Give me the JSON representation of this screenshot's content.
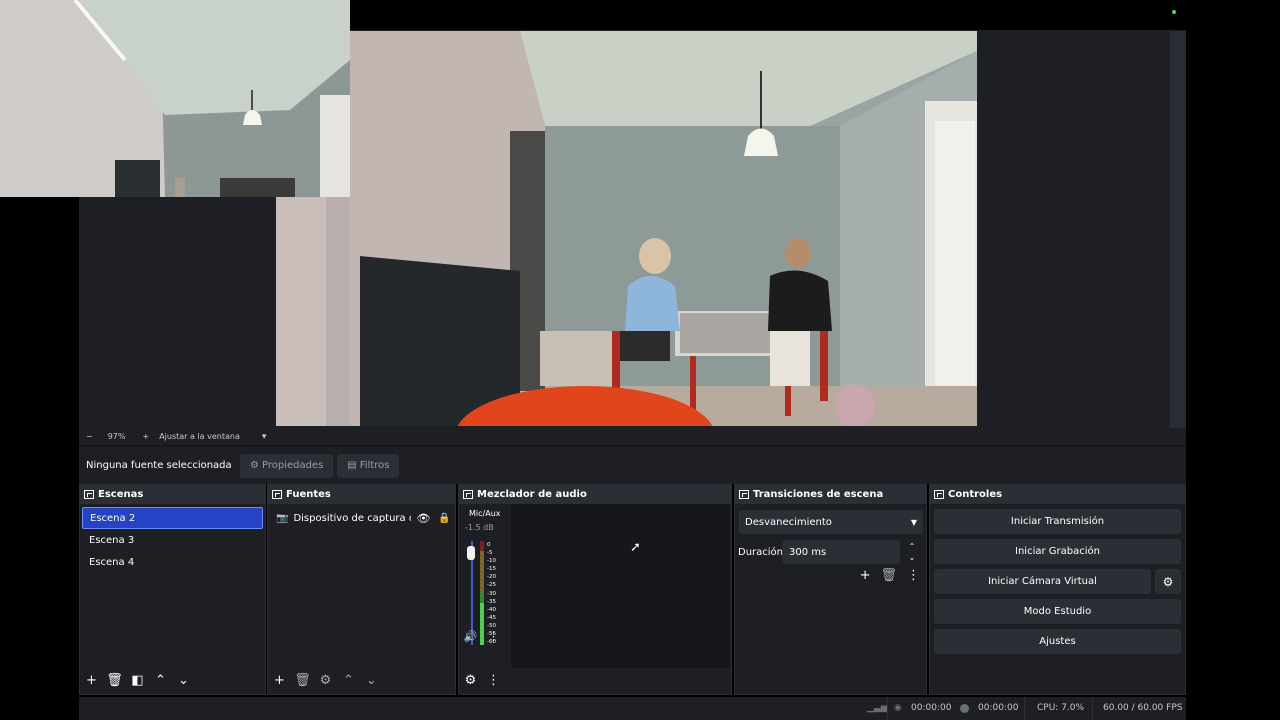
{
  "preview": {
    "zoom_minus": "−",
    "zoom_level": "97%",
    "zoom_plus": "+",
    "fit_label": "Ajustar a la ventana",
    "fit_caret": "▾"
  },
  "source_toolbar": {
    "no_source": "Ninguna fuente seleccionada",
    "properties_label": "Propiedades",
    "filters_label": "Filtros"
  },
  "scenes": {
    "title": "Escenas",
    "items": [
      {
        "label": "Escena 2",
        "selected": true
      },
      {
        "label": "Escena 3",
        "selected": false
      },
      {
        "label": "Escena 4",
        "selected": false
      }
    ]
  },
  "sources": {
    "title": "Fuentes",
    "items": [
      {
        "label": "Dispositivo de captura de vídeo"
      }
    ]
  },
  "mixer": {
    "title": "Mezclador de audio",
    "channel_label": "Mic/Aux",
    "channel_db": "-1.5 dB",
    "scale": [
      "0",
      "-5",
      "-10",
      "-15",
      "-20",
      "-25",
      "-30",
      "-35",
      "-40",
      "-45",
      "-50",
      "-55",
      "-60"
    ]
  },
  "transitions": {
    "title": "Transiciones de escena",
    "selected": "Desvanecimiento",
    "duration_label": "Duración",
    "duration_value": "300 ms"
  },
  "controls": {
    "title": "Controles",
    "start_stream": "Iniciar Transmisión",
    "start_record": "Iniciar Grabación",
    "start_virtual_cam": "Iniciar Cámara Virtual",
    "studio_mode": "Modo Estudio",
    "settings": "Ajustes"
  },
  "status": {
    "stream_time": "00:00:00",
    "record_time": "00:00:00",
    "cpu": "CPU: 7.0%",
    "fps": "60.00 / 60.00 FPS"
  },
  "colors": {
    "panel_bg": "#1e1f24",
    "title_bg": "#2c2e35",
    "selection": "#2543c4"
  }
}
